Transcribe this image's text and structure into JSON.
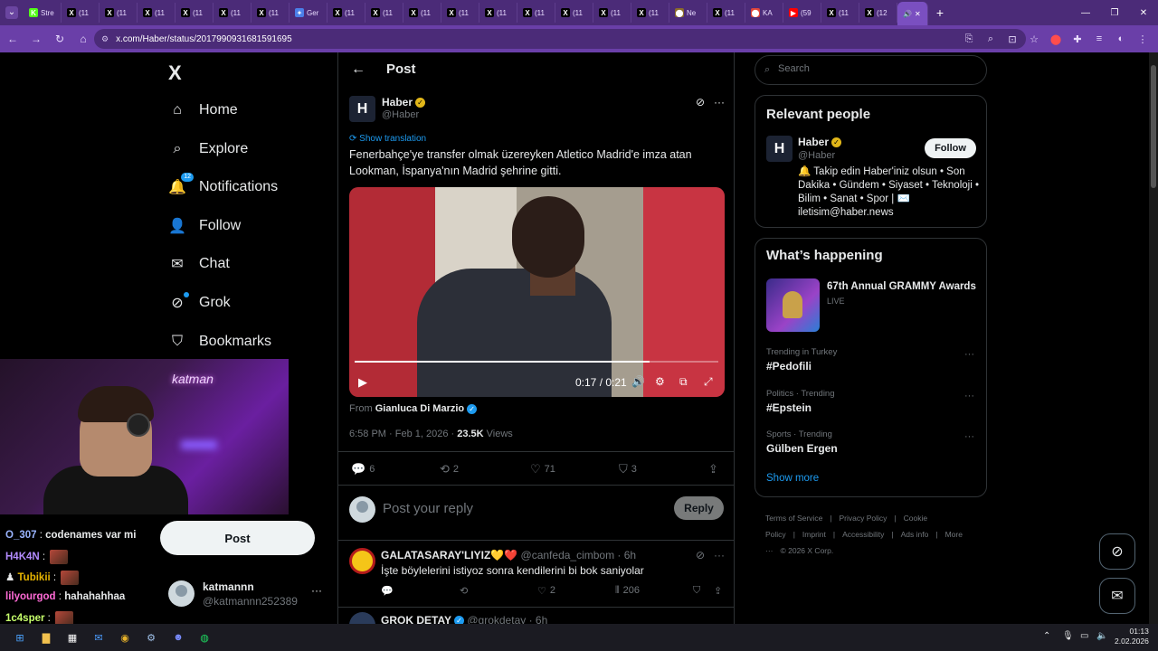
{
  "browser": {
    "tabs": [
      {
        "icon": "K",
        "label": "Stre",
        "color": "#53fc18"
      },
      {
        "icon": "X",
        "label": "(11",
        "color": "#000000"
      },
      {
        "icon": "X",
        "label": "(11",
        "color": "#000000"
      },
      {
        "icon": "X",
        "label": "(11",
        "color": "#000000"
      },
      {
        "icon": "X",
        "label": "(11",
        "color": "#000000"
      },
      {
        "icon": "X",
        "label": "(11",
        "color": "#000000"
      },
      {
        "icon": "X",
        "label": "(11",
        "color": "#000000"
      },
      {
        "icon": "✦",
        "label": "Ger",
        "color": "#4b7fe8"
      },
      {
        "icon": "X",
        "label": "(11",
        "color": "#000000"
      },
      {
        "icon": "X",
        "label": "(11",
        "color": "#000000"
      },
      {
        "icon": "X",
        "label": "(11",
        "color": "#000000"
      },
      {
        "icon": "X",
        "label": "(11",
        "color": "#000000"
      },
      {
        "icon": "X",
        "label": "(11",
        "color": "#000000"
      },
      {
        "icon": "X",
        "label": "(11",
        "color": "#000000"
      },
      {
        "icon": "X",
        "label": "(11",
        "color": "#000000"
      },
      {
        "icon": "X",
        "label": "(11",
        "color": "#000000"
      },
      {
        "icon": "X",
        "label": "(11",
        "color": "#000000"
      },
      {
        "icon": "⬤",
        "label": "Ne",
        "color": "#8a6a2a"
      },
      {
        "icon": "X",
        "label": "(11",
        "color": "#000000"
      },
      {
        "icon": "⬤",
        "label": "KA",
        "color": "#e0453a"
      },
      {
        "icon": "▶",
        "label": "(59",
        "color": "#ff0000"
      },
      {
        "icon": "X",
        "label": "(11",
        "color": "#000000"
      },
      {
        "icon": "X",
        "label": "(12",
        "color": "#000000"
      }
    ],
    "url": "x.com/Haber/status/2017990931681591695"
  },
  "nav": {
    "logo": "X",
    "items": [
      {
        "label": "Home",
        "icon": "⌂"
      },
      {
        "label": "Explore",
        "icon": "⌕"
      },
      {
        "label": "Notifications",
        "icon": "🔔",
        "badge": "12"
      },
      {
        "label": "Follow",
        "icon": "👤"
      },
      {
        "label": "Chat",
        "icon": "✉"
      },
      {
        "label": "Grok",
        "icon": "⊘"
      },
      {
        "label": "Bookmarks",
        "icon": "⛉"
      }
    ],
    "post_button": "Post",
    "account": {
      "name": "katmannn",
      "handle": "@katmannn252389",
      "more": "···"
    }
  },
  "webcam": {
    "neon_text": "katman"
  },
  "stream_chat": [
    {
      "user": "O_307",
      "color": "#9ab4ff",
      "text": "codenames var mi",
      "emote": false
    },
    {
      "user": "H4K4N",
      "color": "#b48cff",
      "text": "",
      "emote": true
    },
    {
      "user": "Tubikii",
      "color": "#e6b400",
      "text": "",
      "emote": true
    },
    {
      "user": "lilyourgod",
      "color": "#ff6bd6",
      "text": "hahahahhaa",
      "emote": false
    },
    {
      "user": "1c4sper",
      "color": "#c6ff6b",
      "text": "",
      "emote": true
    }
  ],
  "main": {
    "title": "Post",
    "post": {
      "avatar_letter": "H",
      "name": "Haber",
      "handle": "@Haber",
      "show_translation": "Show translation",
      "text": "Fenerbahçe'ye transfer olmak üzereyken Atletico Madrid'e imza atan Lookman, İspanya'nın Madrid şehrine gitti.",
      "video": {
        "time": "0:17 / 0:21",
        "progress": 0.81
      },
      "from_label": "From",
      "from_name": "Gianluca Di Marzio",
      "timestamp": "6:58 PM · Feb 1, 2026 · ",
      "views_count": "23.5K",
      "views_label": "Views",
      "actions": {
        "replies": "6",
        "reposts": "2",
        "likes": "71",
        "bookmarks": "3"
      }
    },
    "reply_box": {
      "placeholder": "Post your reply",
      "button": "Reply"
    },
    "replies": [
      {
        "name": "GALATASARAY'LIYIZ💛❤️",
        "handle": "@canfeda_cimbom · 6h",
        "text": "İşte böylelerini istiyoz sonra kendilerini bi bok saniyolar",
        "likes": "2",
        "views": "206"
      },
      {
        "name": "GROK DETAY",
        "handle": "@grokdetay · 6h"
      }
    ]
  },
  "right": {
    "search_placeholder": "Search",
    "relevant": {
      "title": "Relevant people",
      "name": "Haber",
      "handle": "@Haber",
      "follow": "Follow",
      "bio": "🔔 Takip edin Haber'iniz olsun • Son Dakika • Gündem • Siyaset • Teknoloji • Bilim • Sanat • Spor | ✉️ iletisim@haber.news"
    },
    "happening": {
      "title": "What’s happening",
      "live_title": "67th Annual GRAMMY Awards",
      "live_label": "LIVE",
      "trends": [
        {
          "meta": "Trending in Turkey",
          "name": "#Pedofili"
        },
        {
          "meta": "Politics · Trending",
          "name": "#Epstein"
        },
        {
          "meta": "Sports · Trending",
          "name": "Gülben Ergen"
        }
      ],
      "show_more": "Show more"
    },
    "footer": [
      "Terms of Service",
      "|",
      "Privacy Policy",
      "|",
      "Cookie Policy",
      "|",
      "Imprint",
      "|",
      "Accessibility",
      "|",
      "Ads info",
      "|",
      "More ···",
      "© 2026 X Corp."
    ]
  },
  "taskbar": {
    "time": "01:13",
    "date": "2.02.2026"
  }
}
